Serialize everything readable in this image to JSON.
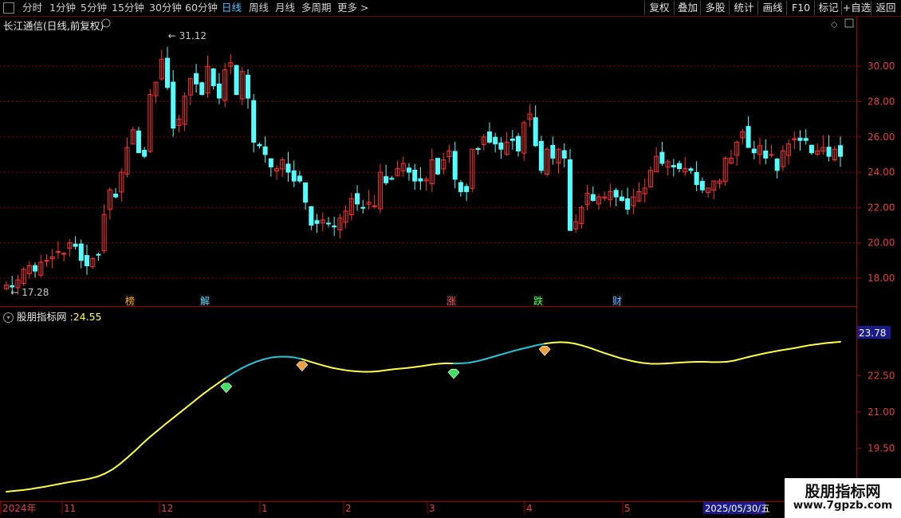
{
  "toolbar": {
    "periods": [
      "分时",
      "1分钟",
      "5分钟",
      "15分钟",
      "30分钟",
      "60分钟",
      "日线",
      "周线",
      "月线",
      "多周期",
      "更多 >"
    ],
    "active_period": "日线",
    "buttons": [
      "复权",
      "叠加",
      "多股",
      "统计",
      "画线",
      "F10",
      "标记",
      "+自选",
      "返回"
    ]
  },
  "chart_title": "长江通信(日线,前复权)",
  "indicator": {
    "name": "股朋指标网",
    "value": "24.55",
    "right_label": "23.78"
  },
  "watermark": {
    "line1": "股朋指标网",
    "line2": "www.7gpzb.com"
  },
  "colors": {
    "up": "#ff3232",
    "down": "#54ffff",
    "line_yellow": "#ffff3c",
    "line_cyan": "#20c8d8",
    "grid": "#8b0000"
  },
  "chart_data": [
    {
      "type": "candlestick",
      "title": "长江通信(日线,前复权)",
      "ylim": [
        16.6,
        32.4
      ],
      "y_ticks": [
        "18.00",
        "20.00",
        "22.00",
        "24.00",
        "26.00",
        "28.00",
        "30.00"
      ],
      "x_labels": [
        "2024年",
        "11",
        "12",
        "1",
        "2",
        "3",
        "4",
        "5"
      ],
      "max_label": "31.12",
      "min_label": "17.28",
      "markers": [
        "榜",
        "解",
        "涨",
        "跌",
        "财"
      ],
      "cursor_date": "2025/05/30/五",
      "series": [
        {
          "name": "close",
          "values": [
            17.6,
            17.5,
            17.9,
            18.5,
            18.7,
            18.4,
            18.9,
            19.0,
            19.2,
            19.5,
            19.4,
            20.0,
            19.8,
            19.0,
            18.7,
            19.1,
            19.3,
            21.6,
            23.0,
            22.6,
            24.0,
            25.4,
            26.4,
            25.1,
            24.9,
            28.4,
            29.1,
            30.4,
            28.8,
            26.5,
            27.0,
            28.3,
            29.3,
            29.0,
            28.4,
            30.0,
            28.9,
            28.2,
            29.8,
            30.2,
            28.4,
            29.7,
            28.2,
            25.7,
            25.5,
            25.0,
            24.3,
            24.2,
            24.7,
            24.0,
            23.5,
            23.5,
            22.3,
            21.0,
            21.1,
            21.3,
            21.1,
            20.9,
            21.4,
            21.8,
            22.5,
            22.2,
            22.0,
            22.3,
            22.1,
            24.0,
            23.4,
            23.6,
            24.2,
            24.5,
            24.0,
            23.5,
            23.5,
            23.6,
            24.7,
            23.9,
            24.7,
            25.2,
            23.6,
            22.9,
            22.9,
            25.3,
            25.3,
            26.0,
            25.7,
            25.6,
            25.3,
            25.7,
            25.8,
            25.2,
            26.8,
            27.3,
            25.5,
            24.1,
            25.3,
            24.8,
            25.3,
            24.8,
            20.7,
            21.2,
            22.0,
            22.8,
            22.4,
            22.6,
            22.6,
            22.9,
            22.6,
            22.4,
            21.9,
            22.6,
            22.9,
            23.1,
            24.1,
            24.9,
            24.5,
            24.6,
            24.3,
            24.2,
            24.2,
            24.1,
            23.3,
            23.0,
            23.1,
            23.5,
            23.5,
            24.8,
            24.8,
            25.7,
            26.3,
            25.4,
            25.1,
            25.5,
            24.8,
            25.0,
            24.1,
            25.2,
            25.6,
            25.9,
            25.8,
            25.8,
            25.1,
            25.2,
            25.4,
            24.9,
            25.3,
            24.9
          ]
        }
      ]
    },
    {
      "type": "line",
      "title": "股朋指标网",
      "ylim": [
        17.6,
        24.85
      ],
      "y_ticks": [
        "18.00",
        "19.50",
        "21.00",
        "22.50"
      ],
      "current_value": "24.55",
      "signals": [
        {
          "kind": "sell",
          "x": 29
        },
        {
          "kind": "buy",
          "x": 39
        },
        {
          "kind": "sell",
          "x": 59
        },
        {
          "kind": "buy",
          "x": 71
        }
      ],
      "series": [
        {
          "name": "股朋指标网",
          "values": [
            17.7,
            17.73,
            17.76,
            17.8,
            17.85,
            17.9,
            17.96,
            18.02,
            18.08,
            18.13,
            18.18,
            18.24,
            18.32,
            18.45,
            18.62,
            18.85,
            19.12,
            19.4,
            19.7,
            19.98,
            20.24,
            20.5,
            20.75,
            21.0,
            21.25,
            21.5,
            21.75,
            21.98,
            22.2,
            22.42,
            22.62,
            22.8,
            22.95,
            23.08,
            23.18,
            23.25,
            23.28,
            23.28,
            23.25,
            23.18,
            23.08,
            22.99,
            22.9,
            22.82,
            22.76,
            22.71,
            22.68,
            22.66,
            22.66,
            22.68,
            22.72,
            22.76,
            22.79,
            22.82,
            22.86,
            22.9,
            22.95,
            22.99,
            23.01,
            23.0,
            23.01,
            23.03,
            23.09,
            23.17,
            23.26,
            23.35,
            23.44,
            23.53,
            23.61,
            23.68,
            23.76,
            23.82,
            23.86,
            23.88,
            23.87,
            23.82,
            23.74,
            23.64,
            23.53,
            23.42,
            23.32,
            23.22,
            23.14,
            23.07,
            23.02,
            22.99,
            22.99,
            23.0,
            23.02,
            23.04,
            23.06,
            23.07,
            23.07,
            23.06,
            23.06,
            23.07,
            23.12,
            23.2,
            23.28,
            23.35,
            23.42,
            23.48,
            23.54,
            23.59,
            23.64,
            23.7,
            23.76,
            23.8,
            23.84,
            23.87,
            23.9
          ]
        }
      ]
    }
  ]
}
